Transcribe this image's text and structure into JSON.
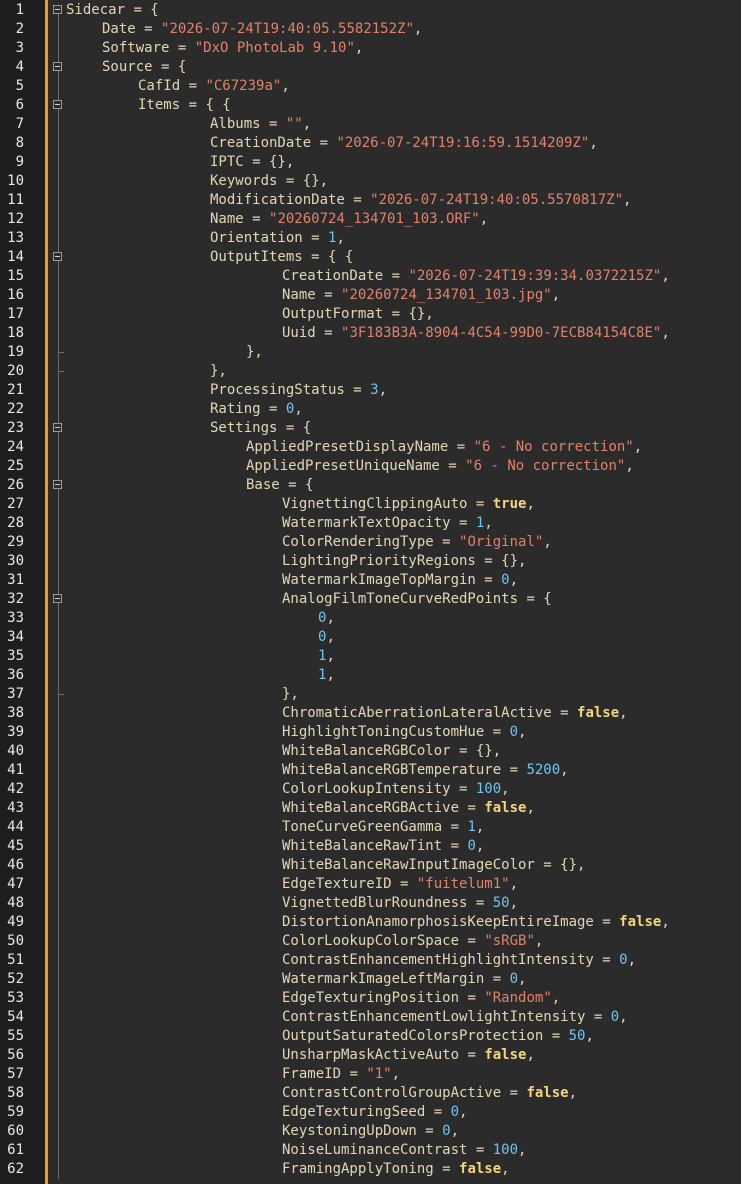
{
  "editor": {
    "colors": {
      "background": "#2b2b2b",
      "gutter": "#1e1e1e",
      "change_bar": "#f39c1c",
      "key": "#e2d7b5",
      "string": "#e0826b",
      "number": "#6fc4f0",
      "boolean": "#f4d67a"
    },
    "fold_icon": "collapse-minus-icon",
    "lines": [
      {
        "n": "1",
        "indent": 0,
        "fold": "open",
        "tokens": [
          [
            "k",
            "Sidecar"
          ],
          [
            "p",
            " = {"
          ]
        ]
      },
      {
        "n": "2",
        "indent": 1,
        "tokens": [
          [
            "k",
            "Date"
          ],
          [
            "p",
            " = "
          ],
          [
            "s",
            "\"2026-07-24T19:40:05.5582152Z\""
          ],
          [
            "p",
            ","
          ]
        ]
      },
      {
        "n": "3",
        "indent": 1,
        "tokens": [
          [
            "k",
            "Software"
          ],
          [
            "p",
            " = "
          ],
          [
            "s",
            "\"DxO PhotoLab 9.10\""
          ],
          [
            "p",
            ","
          ]
        ]
      },
      {
        "n": "4",
        "indent": 1,
        "fold": "open",
        "tokens": [
          [
            "k",
            "Source"
          ],
          [
            "p",
            " = {"
          ]
        ]
      },
      {
        "n": "5",
        "indent": 2,
        "tokens": [
          [
            "k",
            "CafId"
          ],
          [
            "p",
            " = "
          ],
          [
            "s",
            "\"C67239a\""
          ],
          [
            "p",
            ","
          ]
        ]
      },
      {
        "n": "6",
        "indent": 2,
        "fold": "open",
        "tokens": [
          [
            "k",
            "Items"
          ],
          [
            "p",
            " = { {"
          ]
        ]
      },
      {
        "n": "7",
        "indent": 4,
        "tokens": [
          [
            "k",
            "Albums"
          ],
          [
            "p",
            " = "
          ],
          [
            "s",
            "\"\""
          ],
          [
            "p",
            ","
          ]
        ]
      },
      {
        "n": "8",
        "indent": 4,
        "tokens": [
          [
            "k",
            "CreationDate"
          ],
          [
            "p",
            " = "
          ],
          [
            "s",
            "\"2026-07-24T19:16:59.1514209Z\""
          ],
          [
            "p",
            ","
          ]
        ]
      },
      {
        "n": "9",
        "indent": 4,
        "tokens": [
          [
            "k",
            "IPTC"
          ],
          [
            "p",
            " = {},"
          ]
        ]
      },
      {
        "n": "10",
        "indent": 4,
        "tokens": [
          [
            "k",
            "Keywords"
          ],
          [
            "p",
            " = {},"
          ]
        ]
      },
      {
        "n": "11",
        "indent": 4,
        "tokens": [
          [
            "k",
            "ModificationDate"
          ],
          [
            "p",
            " = "
          ],
          [
            "s",
            "\"2026-07-24T19:40:05.5570817Z\""
          ],
          [
            "p",
            ","
          ]
        ]
      },
      {
        "n": "12",
        "indent": 4,
        "tokens": [
          [
            "k",
            "Name"
          ],
          [
            "p",
            " = "
          ],
          [
            "s",
            "\"20260724_134701_103.ORF\""
          ],
          [
            "p",
            ","
          ]
        ]
      },
      {
        "n": "13",
        "indent": 4,
        "tokens": [
          [
            "k",
            "Orientation"
          ],
          [
            "p",
            " = "
          ],
          [
            "n",
            "1"
          ],
          [
            "p",
            ","
          ]
        ]
      },
      {
        "n": "14",
        "indent": 4,
        "fold": "open",
        "tokens": [
          [
            "k",
            "OutputItems"
          ],
          [
            "p",
            " = { {"
          ]
        ]
      },
      {
        "n": "15",
        "indent": 6,
        "tokens": [
          [
            "k",
            "CreationDate"
          ],
          [
            "p",
            " = "
          ],
          [
            "s",
            "\"2026-07-24T19:39:34.0372215Z\""
          ],
          [
            "p",
            ","
          ]
        ]
      },
      {
        "n": "16",
        "indent": 6,
        "tokens": [
          [
            "k",
            "Name"
          ],
          [
            "p",
            " = "
          ],
          [
            "s",
            "\"20260724_134701_103.jpg\""
          ],
          [
            "p",
            ","
          ]
        ]
      },
      {
        "n": "17",
        "indent": 6,
        "tokens": [
          [
            "k",
            "OutputFormat"
          ],
          [
            "p",
            " = {},"
          ]
        ]
      },
      {
        "n": "18",
        "indent": 6,
        "tokens": [
          [
            "k",
            "Uuid"
          ],
          [
            "p",
            " = "
          ],
          [
            "s",
            "\"3F183B3A-8904-4C54-99D0-7ECB84154C8E\""
          ],
          [
            "p",
            ","
          ]
        ]
      },
      {
        "n": "19",
        "indent": 5,
        "fold": "end",
        "tokens": [
          [
            "p",
            "},"
          ]
        ]
      },
      {
        "n": "20",
        "indent": 4,
        "fold": "end",
        "tokens": [
          [
            "p",
            "},"
          ]
        ]
      },
      {
        "n": "21",
        "indent": 4,
        "tokens": [
          [
            "k",
            "ProcessingStatus"
          ],
          [
            "p",
            " = "
          ],
          [
            "n",
            "3"
          ],
          [
            "p",
            ","
          ]
        ]
      },
      {
        "n": "22",
        "indent": 4,
        "tokens": [
          [
            "k",
            "Rating"
          ],
          [
            "p",
            " = "
          ],
          [
            "n",
            "0"
          ],
          [
            "p",
            ","
          ]
        ]
      },
      {
        "n": "23",
        "indent": 4,
        "fold": "open",
        "tokens": [
          [
            "k",
            "Settings"
          ],
          [
            "p",
            " = {"
          ]
        ]
      },
      {
        "n": "24",
        "indent": 5,
        "tokens": [
          [
            "k",
            "AppliedPresetDisplayName"
          ],
          [
            "p",
            " = "
          ],
          [
            "s",
            "\"6 - No correction\""
          ],
          [
            "p",
            ","
          ]
        ]
      },
      {
        "n": "25",
        "indent": 5,
        "tokens": [
          [
            "k",
            "AppliedPresetUniqueName"
          ],
          [
            "p",
            " = "
          ],
          [
            "s",
            "\"6 - No correction\""
          ],
          [
            "p",
            ","
          ]
        ]
      },
      {
        "n": "26",
        "indent": 5,
        "fold": "open",
        "tokens": [
          [
            "k",
            "Base"
          ],
          [
            "p",
            " = {"
          ]
        ]
      },
      {
        "n": "27",
        "indent": 6,
        "tokens": [
          [
            "k",
            "VignettingClippingAuto"
          ],
          [
            "p",
            " = "
          ],
          [
            "b",
            "true"
          ],
          [
            "p",
            ","
          ]
        ]
      },
      {
        "n": "28",
        "indent": 6,
        "tokens": [
          [
            "k",
            "WatermarkTextOpacity"
          ],
          [
            "p",
            " = "
          ],
          [
            "n",
            "1"
          ],
          [
            "p",
            ","
          ]
        ]
      },
      {
        "n": "29",
        "indent": 6,
        "tokens": [
          [
            "k",
            "ColorRenderingType"
          ],
          [
            "p",
            " = "
          ],
          [
            "s",
            "\"Original\""
          ],
          [
            "p",
            ","
          ]
        ]
      },
      {
        "n": "30",
        "indent": 6,
        "tokens": [
          [
            "k",
            "LightingPriorityRegions"
          ],
          [
            "p",
            " = {},"
          ]
        ]
      },
      {
        "n": "31",
        "indent": 6,
        "tokens": [
          [
            "k",
            "WatermarkImageTopMargin"
          ],
          [
            "p",
            " = "
          ],
          [
            "n",
            "0"
          ],
          [
            "p",
            ","
          ]
        ]
      },
      {
        "n": "32",
        "indent": 6,
        "fold": "open",
        "tokens": [
          [
            "k",
            "AnalogFilmToneCurveRedPoints"
          ],
          [
            "p",
            " = {"
          ]
        ]
      },
      {
        "n": "33",
        "indent": 7,
        "tokens": [
          [
            "n",
            "0"
          ],
          [
            "p",
            ","
          ]
        ]
      },
      {
        "n": "34",
        "indent": 7,
        "tokens": [
          [
            "n",
            "0"
          ],
          [
            "p",
            ","
          ]
        ]
      },
      {
        "n": "35",
        "indent": 7,
        "tokens": [
          [
            "n",
            "1"
          ],
          [
            "p",
            ","
          ]
        ]
      },
      {
        "n": "36",
        "indent": 7,
        "tokens": [
          [
            "n",
            "1"
          ],
          [
            "p",
            ","
          ]
        ]
      },
      {
        "n": "37",
        "indent": 6,
        "fold": "end",
        "tokens": [
          [
            "p",
            "},"
          ]
        ]
      },
      {
        "n": "38",
        "indent": 6,
        "tokens": [
          [
            "k",
            "ChromaticAberrationLateralActive"
          ],
          [
            "p",
            " = "
          ],
          [
            "b",
            "false"
          ],
          [
            "p",
            ","
          ]
        ]
      },
      {
        "n": "39",
        "indent": 6,
        "tokens": [
          [
            "k",
            "HighlightToningCustomHue"
          ],
          [
            "p",
            " = "
          ],
          [
            "n",
            "0"
          ],
          [
            "p",
            ","
          ]
        ]
      },
      {
        "n": "40",
        "indent": 6,
        "tokens": [
          [
            "k",
            "WhiteBalanceRGBColor"
          ],
          [
            "p",
            " = {},"
          ]
        ]
      },
      {
        "n": "41",
        "indent": 6,
        "tokens": [
          [
            "k",
            "WhiteBalanceRGBTemperature"
          ],
          [
            "p",
            " = "
          ],
          [
            "n",
            "5200"
          ],
          [
            "p",
            ","
          ]
        ]
      },
      {
        "n": "42",
        "indent": 6,
        "tokens": [
          [
            "k",
            "ColorLookupIntensity"
          ],
          [
            "p",
            " = "
          ],
          [
            "n",
            "100"
          ],
          [
            "p",
            ","
          ]
        ]
      },
      {
        "n": "43",
        "indent": 6,
        "tokens": [
          [
            "k",
            "WhiteBalanceRGBActive"
          ],
          [
            "p",
            " = "
          ],
          [
            "b",
            "false"
          ],
          [
            "p",
            ","
          ]
        ]
      },
      {
        "n": "44",
        "indent": 6,
        "tokens": [
          [
            "k",
            "ToneCurveGreenGamma"
          ],
          [
            "p",
            " = "
          ],
          [
            "n",
            "1"
          ],
          [
            "p",
            ","
          ]
        ]
      },
      {
        "n": "45",
        "indent": 6,
        "tokens": [
          [
            "k",
            "WhiteBalanceRawTint"
          ],
          [
            "p",
            " = "
          ],
          [
            "n",
            "0"
          ],
          [
            "p",
            ","
          ]
        ]
      },
      {
        "n": "46",
        "indent": 6,
        "tokens": [
          [
            "k",
            "WhiteBalanceRawInputImageColor"
          ],
          [
            "p",
            " = {},"
          ]
        ]
      },
      {
        "n": "47",
        "indent": 6,
        "tokens": [
          [
            "k",
            "EdgeTextureID"
          ],
          [
            "p",
            " = "
          ],
          [
            "s",
            "\"fuitelum1\""
          ],
          [
            "p",
            ","
          ]
        ]
      },
      {
        "n": "48",
        "indent": 6,
        "tokens": [
          [
            "k",
            "VignettedBlurRoundness"
          ],
          [
            "p",
            " = "
          ],
          [
            "n",
            "50"
          ],
          [
            "p",
            ","
          ]
        ]
      },
      {
        "n": "49",
        "indent": 6,
        "tokens": [
          [
            "k",
            "DistortionAnamorphosisKeepEntireImage"
          ],
          [
            "p",
            " = "
          ],
          [
            "b",
            "false"
          ],
          [
            "p",
            ","
          ]
        ]
      },
      {
        "n": "50",
        "indent": 6,
        "tokens": [
          [
            "k",
            "ColorLookupColorSpace"
          ],
          [
            "p",
            " = "
          ],
          [
            "s",
            "\"sRGB\""
          ],
          [
            "p",
            ","
          ]
        ]
      },
      {
        "n": "51",
        "indent": 6,
        "tokens": [
          [
            "k",
            "ContrastEnhancementHighlightIntensity"
          ],
          [
            "p",
            " = "
          ],
          [
            "n",
            "0"
          ],
          [
            "p",
            ","
          ]
        ]
      },
      {
        "n": "52",
        "indent": 6,
        "tokens": [
          [
            "k",
            "WatermarkImageLeftMargin"
          ],
          [
            "p",
            " = "
          ],
          [
            "n",
            "0"
          ],
          [
            "p",
            ","
          ]
        ]
      },
      {
        "n": "53",
        "indent": 6,
        "tokens": [
          [
            "k",
            "EdgeTexturingPosition"
          ],
          [
            "p",
            " = "
          ],
          [
            "s",
            "\"Random\""
          ],
          [
            "p",
            ","
          ]
        ]
      },
      {
        "n": "54",
        "indent": 6,
        "tokens": [
          [
            "k",
            "ContrastEnhancementLowlightIntensity"
          ],
          [
            "p",
            " = "
          ],
          [
            "n",
            "0"
          ],
          [
            "p",
            ","
          ]
        ]
      },
      {
        "n": "55",
        "indent": 6,
        "tokens": [
          [
            "k",
            "OutputSaturatedColorsProtection"
          ],
          [
            "p",
            " = "
          ],
          [
            "n",
            "50"
          ],
          [
            "p",
            ","
          ]
        ]
      },
      {
        "n": "56",
        "indent": 6,
        "tokens": [
          [
            "k",
            "UnsharpMaskActiveAuto"
          ],
          [
            "p",
            " = "
          ],
          [
            "b",
            "false"
          ],
          [
            "p",
            ","
          ]
        ]
      },
      {
        "n": "57",
        "indent": 6,
        "tokens": [
          [
            "k",
            "FrameID"
          ],
          [
            "p",
            " = "
          ],
          [
            "s",
            "\"1\""
          ],
          [
            "p",
            ","
          ]
        ]
      },
      {
        "n": "58",
        "indent": 6,
        "tokens": [
          [
            "k",
            "ContrastControlGroupActive"
          ],
          [
            "p",
            " = "
          ],
          [
            "b",
            "false"
          ],
          [
            "p",
            ","
          ]
        ]
      },
      {
        "n": "59",
        "indent": 6,
        "tokens": [
          [
            "k",
            "EdgeTexturingSeed"
          ],
          [
            "p",
            " = "
          ],
          [
            "n",
            "0"
          ],
          [
            "p",
            ","
          ]
        ]
      },
      {
        "n": "60",
        "indent": 6,
        "tokens": [
          [
            "k",
            "KeystoningUpDown"
          ],
          [
            "p",
            " = "
          ],
          [
            "n",
            "0"
          ],
          [
            "p",
            ","
          ]
        ]
      },
      {
        "n": "61",
        "indent": 6,
        "tokens": [
          [
            "k",
            "NoiseLuminanceContrast"
          ],
          [
            "p",
            " = "
          ],
          [
            "n",
            "100"
          ],
          [
            "p",
            ","
          ]
        ]
      },
      {
        "n": "62",
        "indent": 6,
        "tokens": [
          [
            "k",
            "FramingApplyToning"
          ],
          [
            "p",
            " = "
          ],
          [
            "b",
            "false"
          ],
          [
            "p",
            ","
          ]
        ]
      }
    ]
  }
}
